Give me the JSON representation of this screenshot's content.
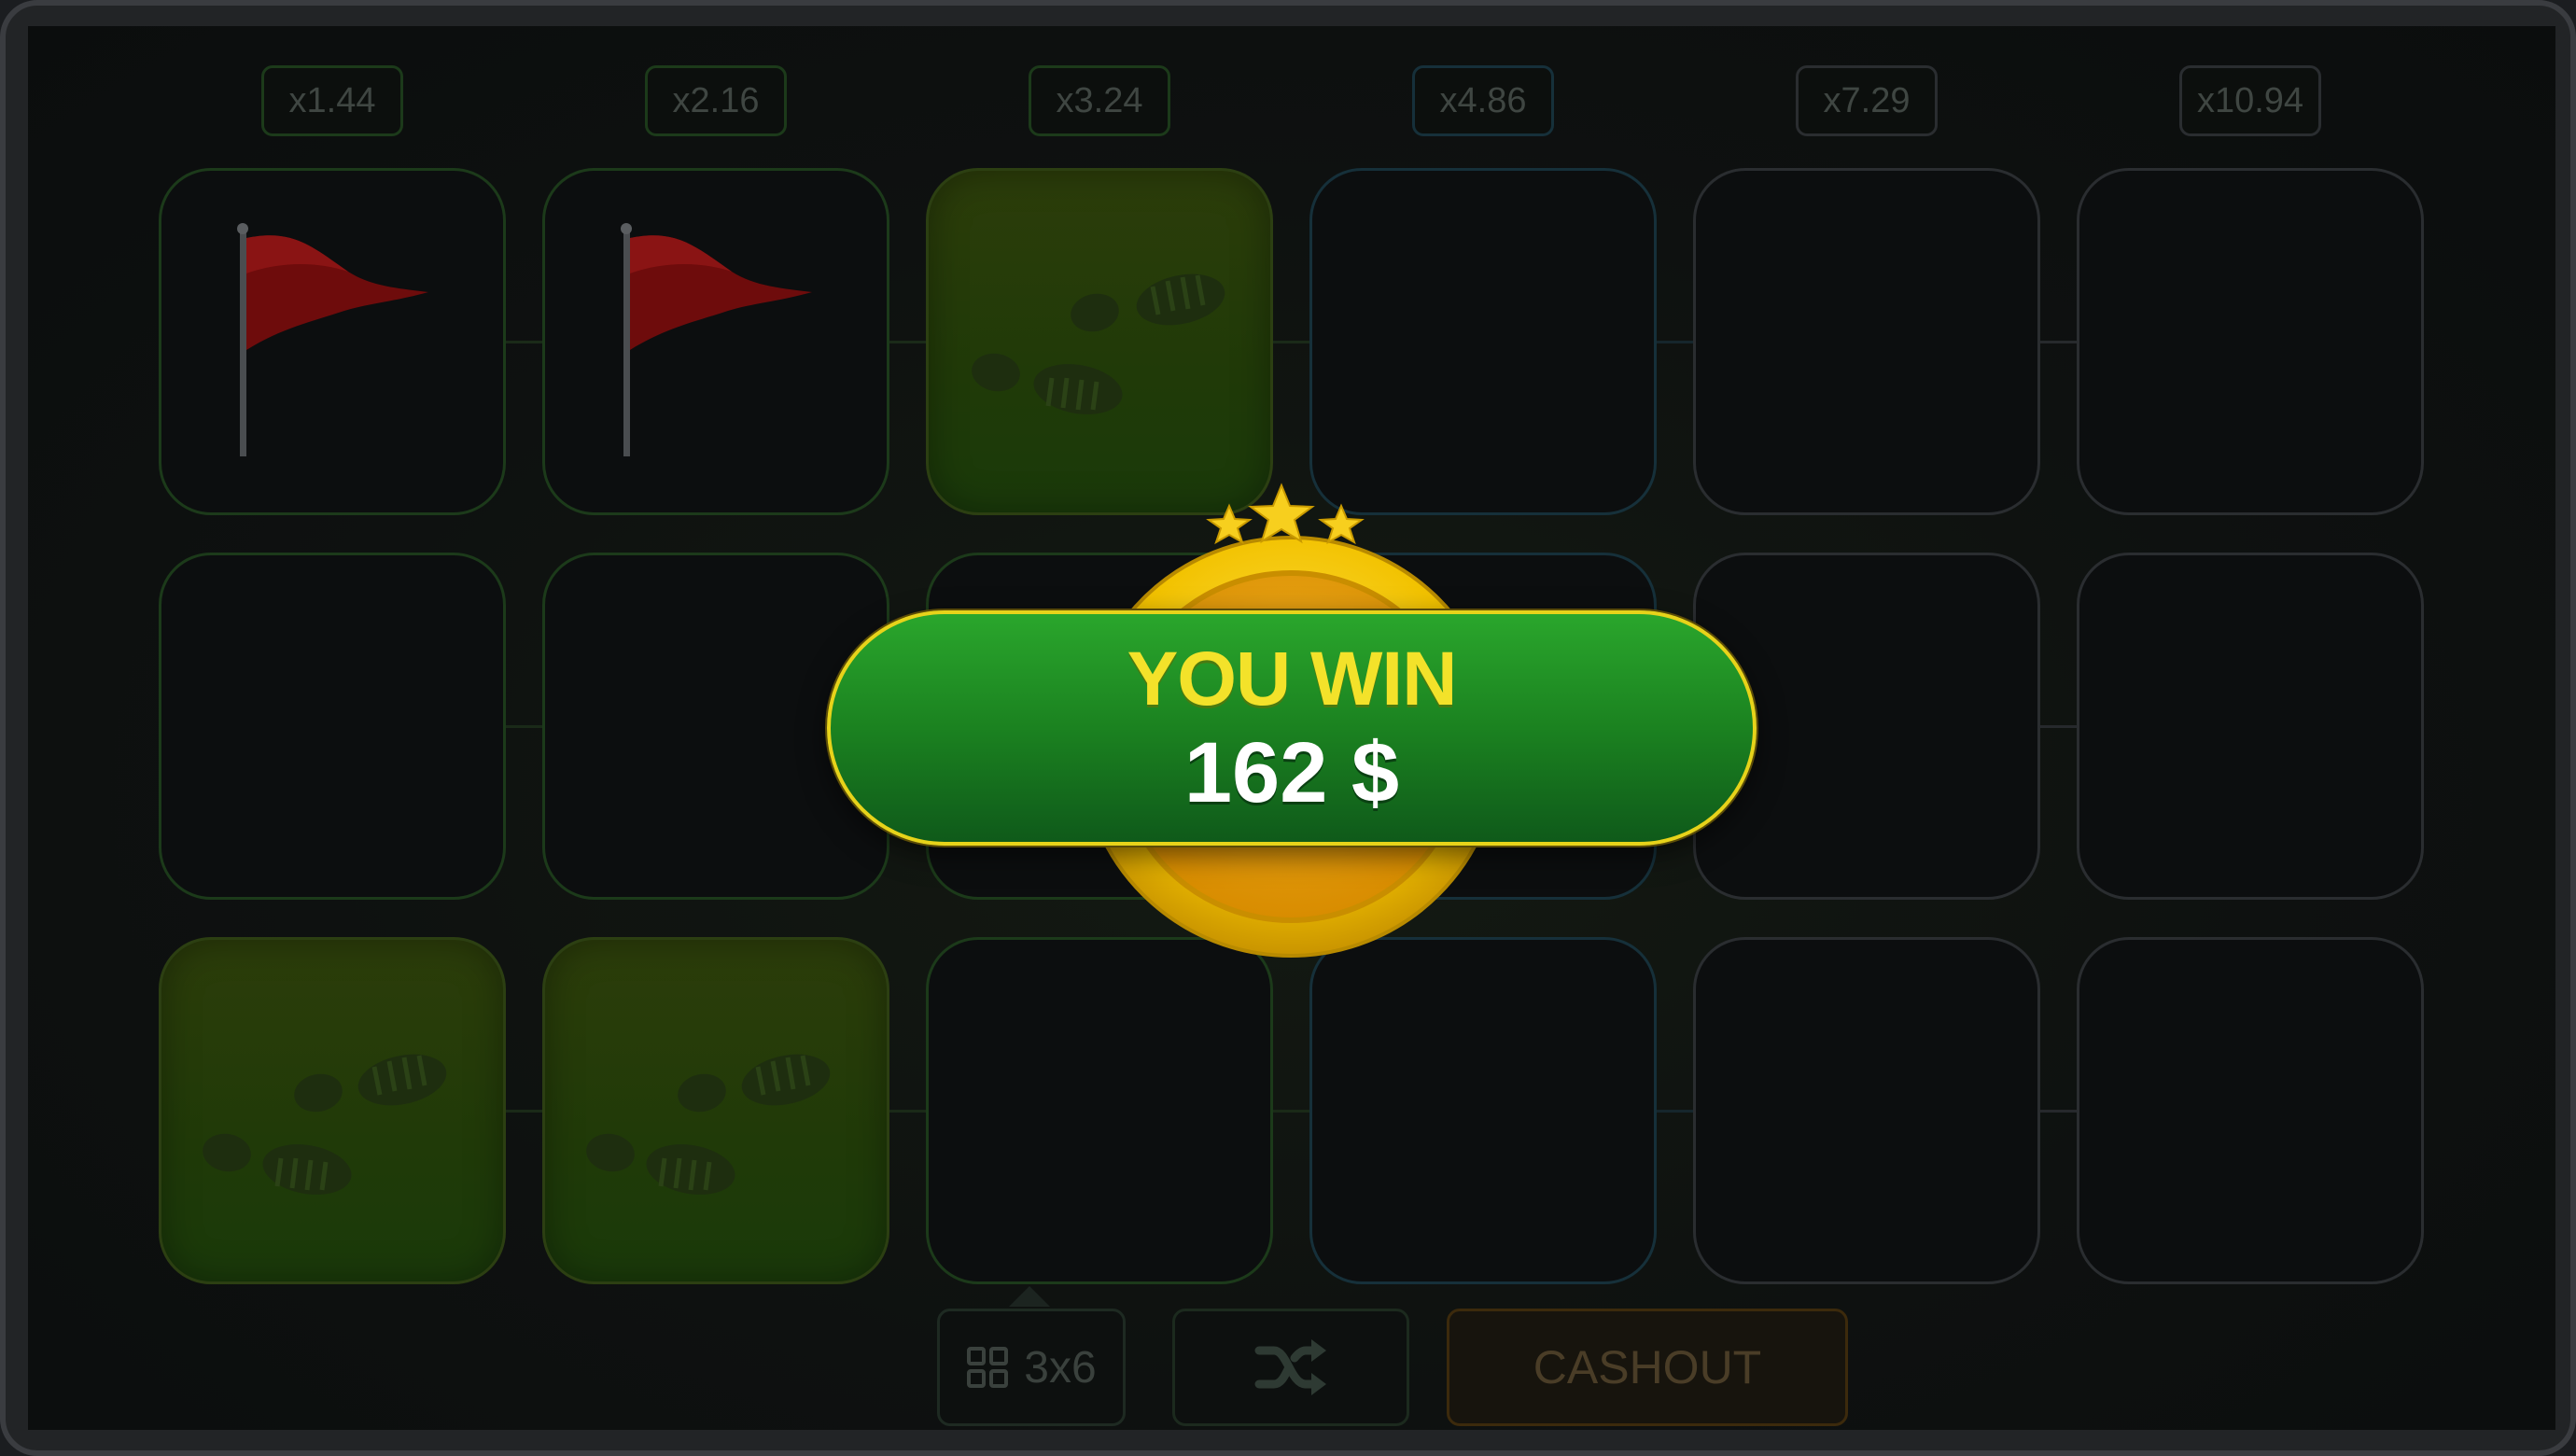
{
  "multipliers": [
    "x1.44",
    "x2.16",
    "x3.24",
    "x4.86",
    "x7.29",
    "x10.94"
  ],
  "grid": {
    "rows": [
      [
        "flag",
        "flag",
        "step",
        "empty",
        "empty",
        "empty"
      ],
      [
        "empty",
        "empty",
        "empty",
        "empty",
        "empty",
        "empty"
      ],
      [
        "step",
        "step",
        "empty",
        "empty",
        "empty",
        "empty"
      ]
    ]
  },
  "controls": {
    "grid_size_label": "3x6",
    "grid_icon": "grid-icon",
    "shuffle_icon": "shuffle-icon",
    "cashout_label": "CASHOUT"
  },
  "win": {
    "title": "YOU WIN",
    "amount": "162 $"
  },
  "colors": {
    "win_green": "#1b8220",
    "win_gold": "#f2c200",
    "win_title_yellow": "#f3e22a",
    "flag_red": "#7a1010",
    "step_green": "#203a08"
  }
}
